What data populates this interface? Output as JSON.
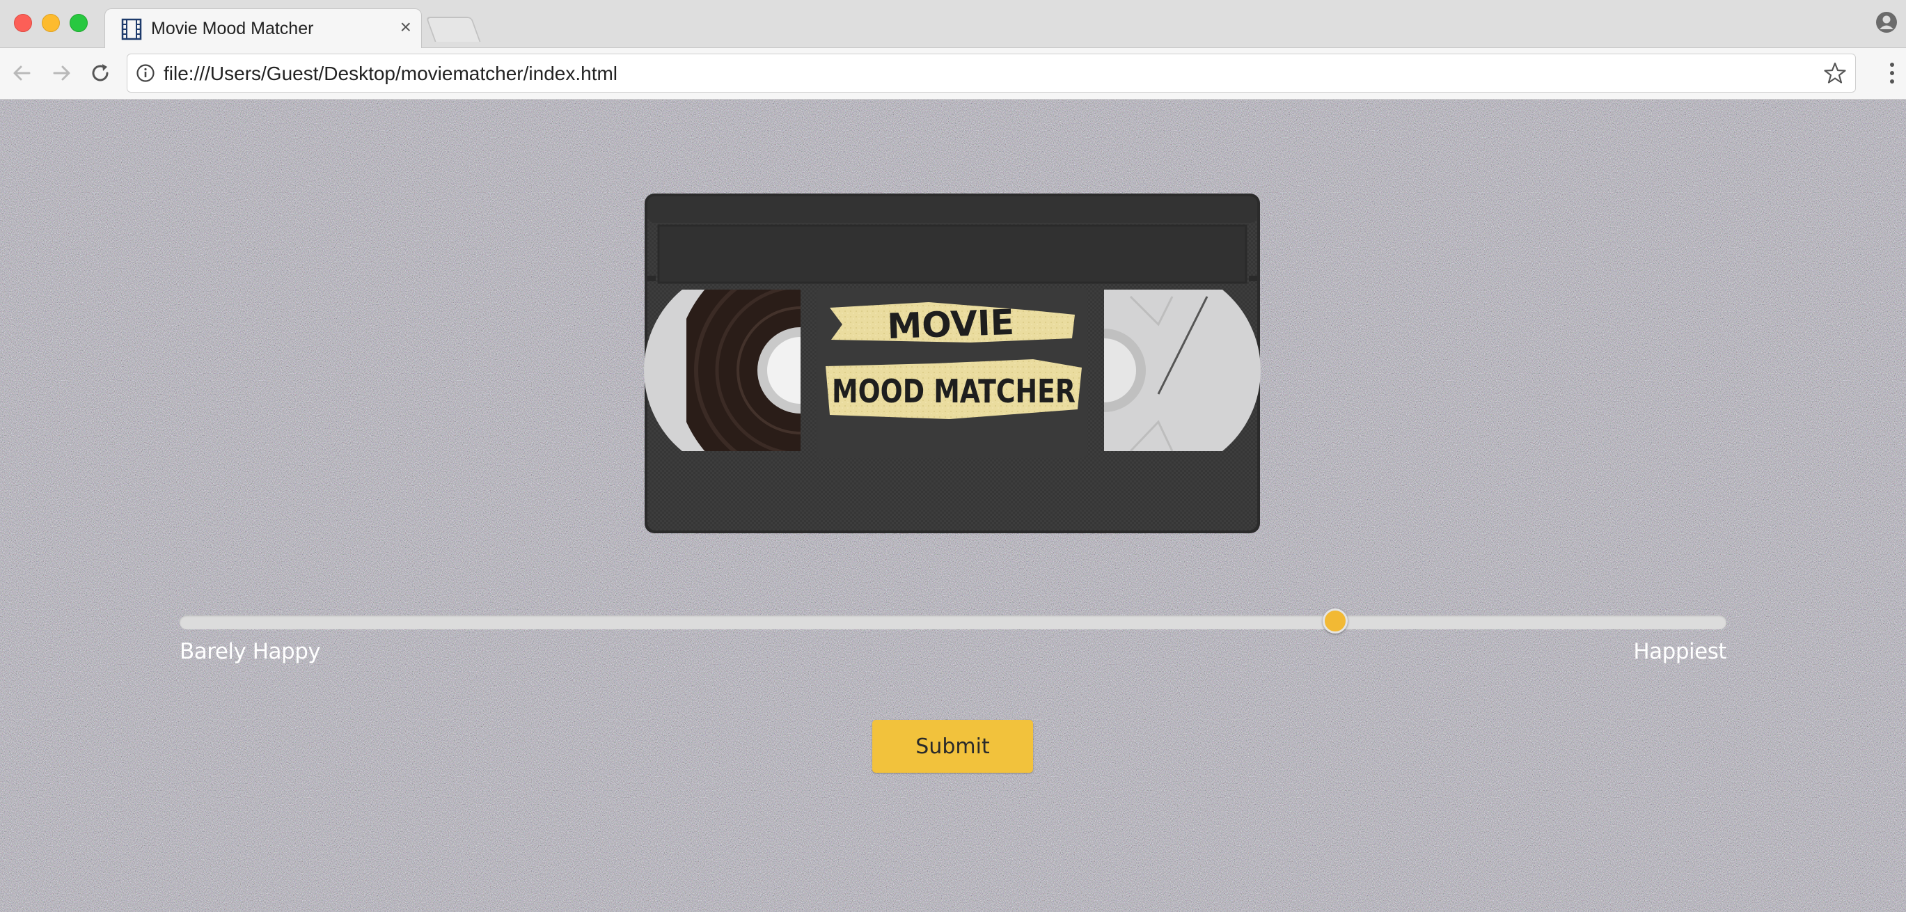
{
  "browser": {
    "tab_title": "Movie Mood Matcher",
    "tab_close": "×",
    "url": "file:///Users/Guest/Desktop/moviematcher/index.html"
  },
  "cassette": {
    "label_line1": "MOVIE",
    "label_line2": "MOOD MATCHER"
  },
  "mood_slider": {
    "min_label": "Barely Happy",
    "max_label": "Happiest",
    "value_fraction": 0.747
  },
  "submit_label": "Submit",
  "colors": {
    "accent": "#f2b934",
    "button": "#f2c23c",
    "tape_label": "#e8d9a0",
    "cassette_body": "#3a3a3a"
  }
}
